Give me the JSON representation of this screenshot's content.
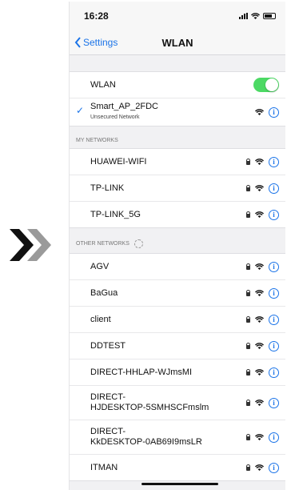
{
  "status": {
    "time": "16:28"
  },
  "nav": {
    "back_label": "Settings",
    "title": "WLAN"
  },
  "wlan": {
    "label": "WLAN",
    "toggle_on": true,
    "toggle_color": "#4cd964"
  },
  "connected": {
    "name": "Smart_AP_2FDC",
    "sub": "Unsecured Network"
  },
  "my_networks": {
    "header": "MY NETWORKS",
    "items": [
      {
        "name": "HUAWEI-WIFI",
        "locked": true
      },
      {
        "name": "TP-LINK",
        "locked": true
      },
      {
        "name": "TP-LINK_5G",
        "locked": true
      }
    ]
  },
  "other_networks": {
    "header": "OTHER NETWORKS",
    "items": [
      {
        "name": "AGV",
        "locked": true
      },
      {
        "name": "BaGua",
        "locked": true
      },
      {
        "name": "client",
        "locked": true
      },
      {
        "name": "DDTEST",
        "locked": true
      },
      {
        "name": "DIRECT-HHLAP-WJmsMI",
        "locked": true
      },
      {
        "name": "DIRECT-\nHJDESKTOP-5SMHSCFmslm",
        "locked": true
      },
      {
        "name": "DIRECT-\nKkDESKTOP-0AB69I9msLR",
        "locked": true
      },
      {
        "name": "ITMAN",
        "locked": true
      }
    ]
  },
  "colors": {
    "accent": "#1a73e8",
    "toggle_on": "#4cd964"
  },
  "icons": [
    "chevron-right-icon",
    "back-chevron-icon",
    "checkmark-icon",
    "lock-icon",
    "wifi-icon",
    "info-icon",
    "spinner-icon"
  ]
}
